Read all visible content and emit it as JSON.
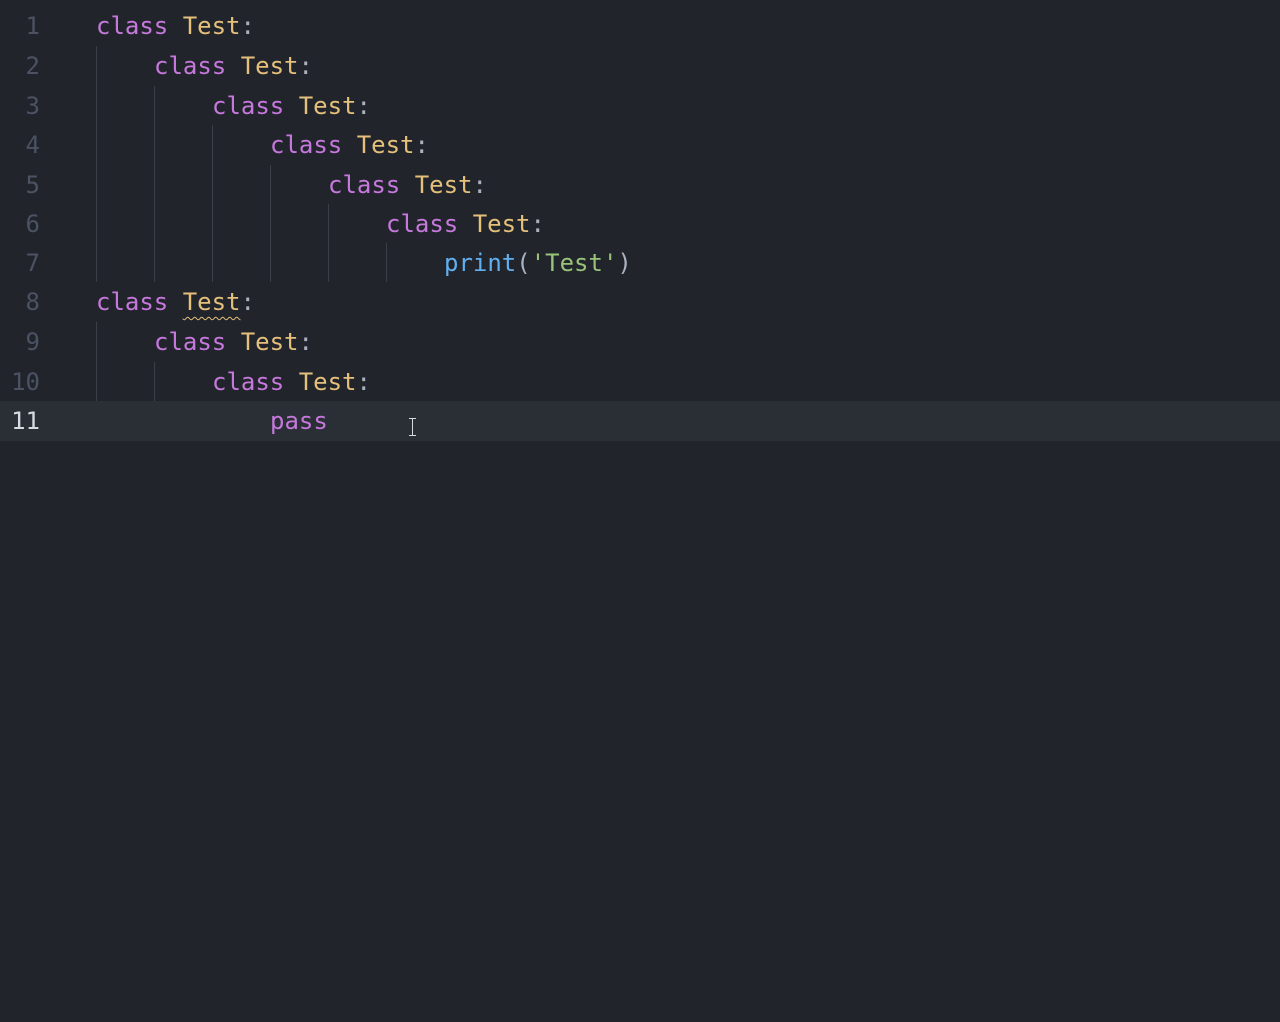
{
  "editor": {
    "language": "python",
    "current_line": 11,
    "lines": [
      {
        "number": "1",
        "keyword": "class",
        "name": "Test",
        "punct": ":"
      },
      {
        "number": "2",
        "keyword": "class",
        "name": "Test",
        "punct": ":"
      },
      {
        "number": "3",
        "keyword": "class",
        "name": "Test",
        "punct": ":"
      },
      {
        "number": "4",
        "keyword": "class",
        "name": "Test",
        "punct": ":"
      },
      {
        "number": "5",
        "keyword": "class",
        "name": "Test",
        "punct": ":"
      },
      {
        "number": "6",
        "keyword": "class",
        "name": "Test",
        "punct": ":"
      },
      {
        "number": "7",
        "func": "print",
        "open": "(",
        "string": "'Test'",
        "close": ")"
      },
      {
        "number": "8",
        "keyword": "class",
        "name": "Test",
        "punct": ":"
      },
      {
        "number": "9",
        "keyword": "class",
        "name": "Test",
        "punct": ":"
      },
      {
        "number": "10",
        "keyword": "class",
        "name": "Test",
        "punct": ":"
      },
      {
        "number": "11",
        "keyword": "pass"
      }
    ]
  },
  "colors": {
    "background": "#21252b",
    "keyword": "#c678dd",
    "class_name": "#e5c07b",
    "function": "#61afef",
    "string": "#98c379",
    "line_number": "#4b5263",
    "line_number_active": "#d7dae0"
  }
}
